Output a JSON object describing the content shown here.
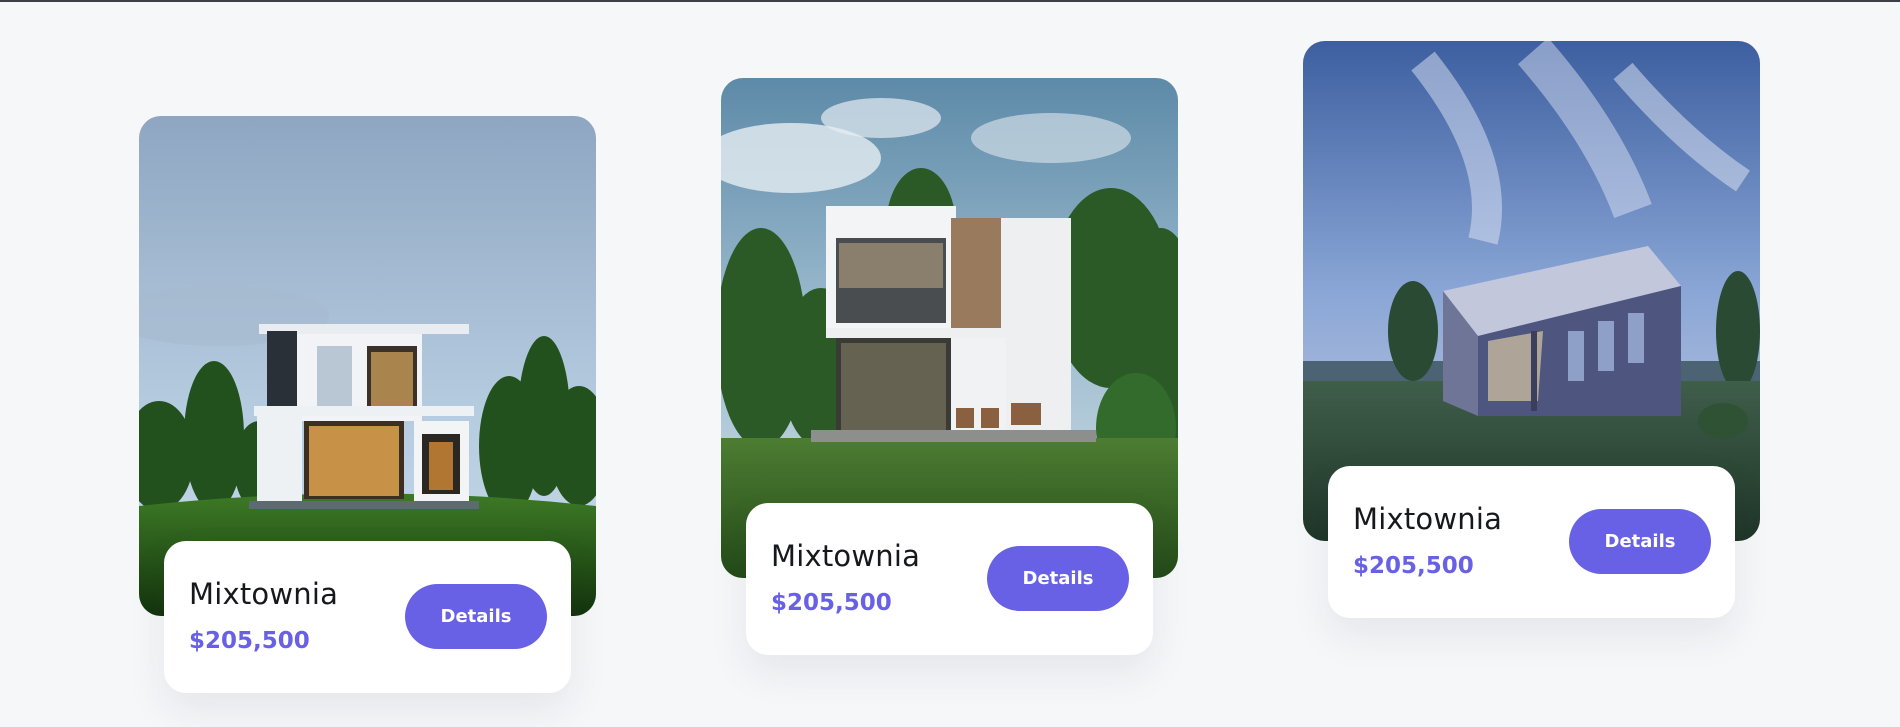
{
  "listings": [
    {
      "title": "Mixtownia",
      "price": "$205,500",
      "button_label": "Details",
      "photo": "modern-two-story-house-photo",
      "accent_color": "#6861e6"
    },
    {
      "title": "Mixtownia",
      "price": "$205,500",
      "button_label": "Details",
      "photo": "white-modern-villa-photo",
      "accent_color": "#6861e6"
    },
    {
      "title": "Mixtownia",
      "price": "$205,500",
      "button_label": "Details",
      "photo": "angular-dark-house-photo",
      "accent_color": "#6861e6"
    }
  ]
}
